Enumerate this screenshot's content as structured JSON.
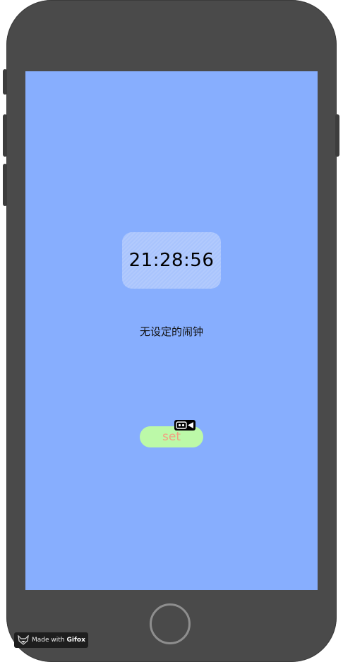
{
  "clock": {
    "time": "21:28:56"
  },
  "alarm": {
    "status_text": "无设定的闹钟"
  },
  "controls": {
    "set_label": "set"
  },
  "watermark": {
    "prefix": "Made with",
    "brand": "Gifox"
  },
  "colors": {
    "screen_bg": "#87aefe",
    "time_box_bg": "#a9c4fd",
    "set_button_bg": "#bcf9a8",
    "set_button_text": "#f2a182",
    "device_frame": "#4a4a4a"
  },
  "icons": [
    "fox-icon",
    "camera-badge-icon",
    "home-button"
  ]
}
